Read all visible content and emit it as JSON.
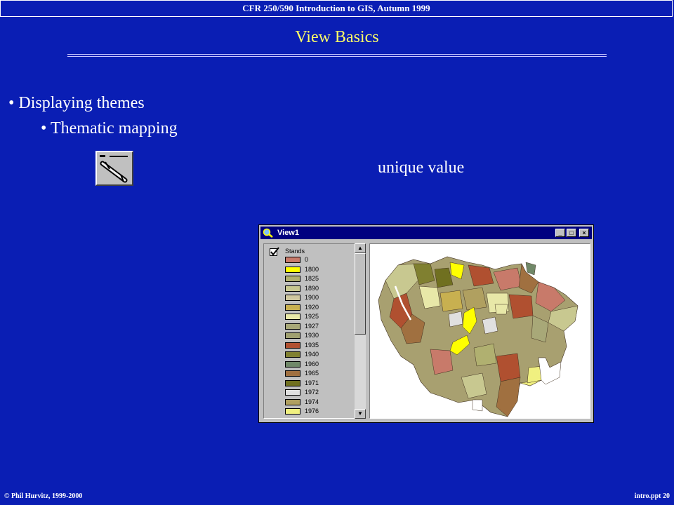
{
  "header": {
    "course": "CFR 250/590 Introduction to GIS, Autumn 1999"
  },
  "slide": {
    "title": "View Basics",
    "bullet1": "Displaying themes",
    "bullet2": "Thematic mapping",
    "label": "unique value"
  },
  "window": {
    "title": "View1",
    "minimize": "_",
    "maximize": "□",
    "close": "×",
    "theme_name": "Stands",
    "legend": [
      {
        "label": "0",
        "color": "#c87a6a"
      },
      {
        "label": "1800",
        "color": "#ffff00"
      },
      {
        "label": "1825",
        "color": "#b0b070"
      },
      {
        "label": "1890",
        "color": "#c8c890"
      },
      {
        "label": "1900",
        "color": "#d0c8a0"
      },
      {
        "label": "1920",
        "color": "#c8b050"
      },
      {
        "label": "1925",
        "color": "#e8e8a8"
      },
      {
        "label": "1927",
        "color": "#a8a878"
      },
      {
        "label": "1930",
        "color": "#a0a070"
      },
      {
        "label": "1935",
        "color": "#b05030"
      },
      {
        "label": "1940",
        "color": "#808030"
      },
      {
        "label": "1960",
        "color": "#708868"
      },
      {
        "label": "1965",
        "color": "#a07040"
      },
      {
        "label": "1971",
        "color": "#707020"
      },
      {
        "label": "1972",
        "color": "#e0e0e0"
      },
      {
        "label": "1974",
        "color": "#b0a060"
      },
      {
        "label": "1976",
        "color": "#f0f080"
      }
    ]
  },
  "footer": {
    "left": "© Phil Hurvitz, 1999-2000",
    "right": "intro.ppt 20"
  }
}
